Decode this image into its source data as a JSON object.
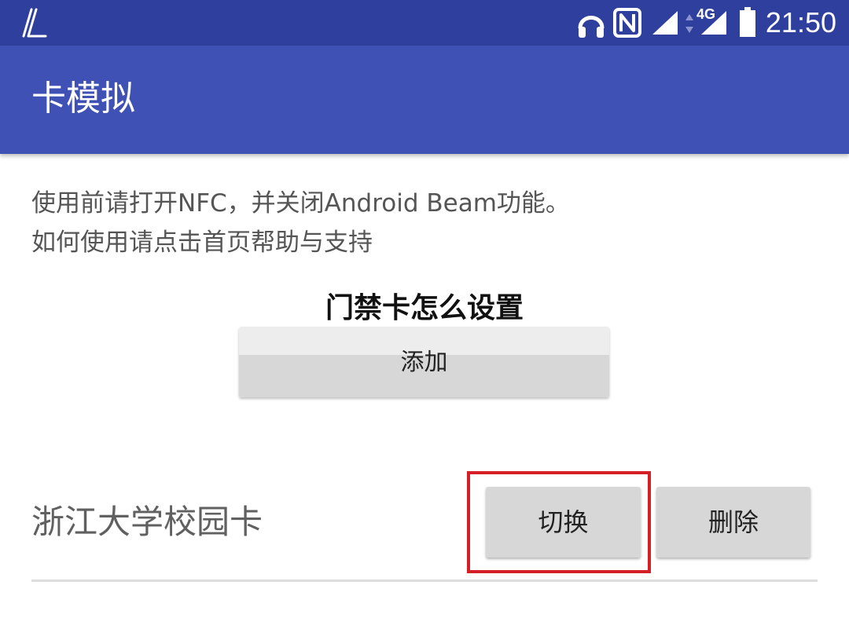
{
  "status_bar": {
    "time": "21:50",
    "network_type": "4G",
    "colors": {
      "background": "#2f3f9e"
    },
    "icons": [
      "app-logo-icon",
      "headphones-icon",
      "nfc-icon",
      "signal-icon",
      "data-arrows-icon",
      "signal-4g-icon",
      "battery-icon"
    ]
  },
  "app_bar": {
    "title": "卡模拟",
    "colors": {
      "background": "#3f51b5"
    }
  },
  "instructions": {
    "line1": "使用前请打开NFC，并关闭Android Beam功能。",
    "line2": "如何使用请点击首页帮助与支持"
  },
  "overlay": {
    "title": "门禁卡怎么设置"
  },
  "add_button": {
    "label": "添加"
  },
  "cards": [
    {
      "name": "浙江大学校园卡",
      "switch_label": "切换",
      "delete_label": "删除"
    }
  ],
  "highlight": {
    "color": "#d41f27",
    "target": "切换"
  }
}
